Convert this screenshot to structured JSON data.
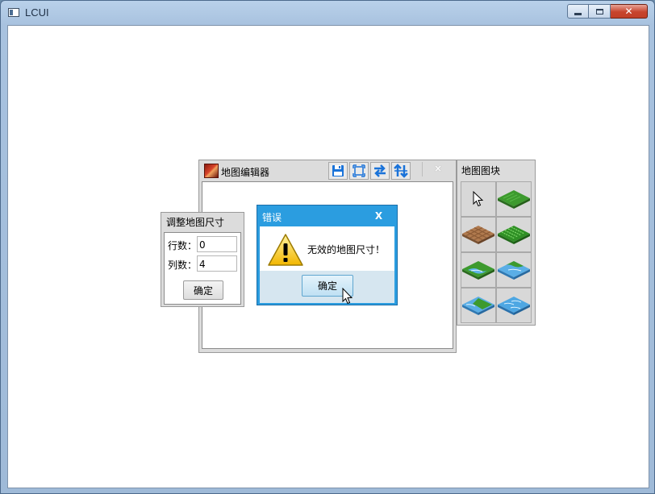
{
  "window": {
    "title": "LCUI",
    "controls": {
      "minimize": "minimize",
      "maximize": "maximize",
      "close": "close"
    }
  },
  "map_editor": {
    "title": "地图编辑器",
    "toolbar": [
      {
        "icon": "save-icon"
      },
      {
        "icon": "fit-frame-icon"
      },
      {
        "icon": "horizontal-flip-icon"
      },
      {
        "icon": "vertical-flip-icon"
      }
    ],
    "close_label": "×"
  },
  "resize_panel": {
    "title": "调整地图尺寸",
    "rows_label": "行数：",
    "rows_value": "0",
    "cols_label": "列数：",
    "cols_value": "4",
    "confirm_label": "确定"
  },
  "tiles_panel": {
    "title": "地图图块",
    "tiles": [
      "pointer-tool",
      "grass-tile",
      "dirt-tile",
      "crop-field-tile",
      "grass-water-tile",
      "water-grass-tile",
      "water-island-tile",
      "water-tile"
    ]
  },
  "error_dialog": {
    "title": "错误",
    "close_label": "X",
    "message": "无效的地图尺寸！",
    "ok_label": "确定",
    "icon": "warning-icon"
  },
  "colors": {
    "dialog_accent": "#2b9de0",
    "panel_bg": "#dcdcdc",
    "tool_icon_blue": "#1a73d9"
  }
}
